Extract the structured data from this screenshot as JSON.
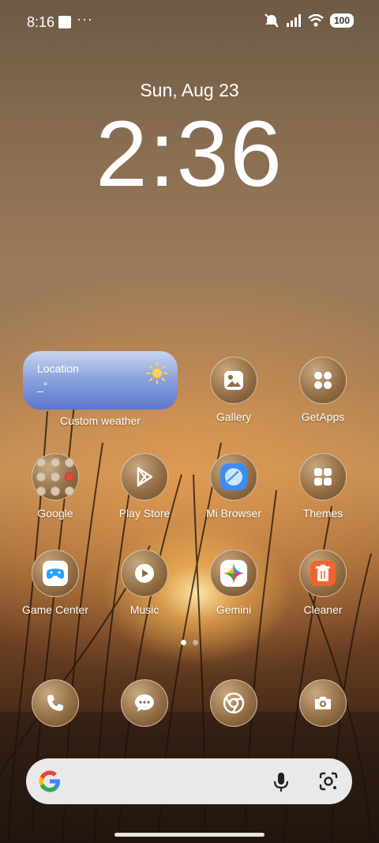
{
  "status_bar": {
    "time": "8:16",
    "notif_more": "···",
    "battery": "100"
  },
  "lockscreen": {
    "date": "Sun, Aug 23",
    "time": "2:36"
  },
  "weather_widget": {
    "location": "Location",
    "temp": "_°",
    "label": "Custom weather"
  },
  "apps": [
    {
      "label": "Gallery",
      "icon": "gallery-icon"
    },
    {
      "label": "GetApps",
      "icon": "getapps-icon"
    },
    {
      "label": "Google",
      "icon": "folder-icon"
    },
    {
      "label": "Play Store",
      "icon": "play-store-icon"
    },
    {
      "label": "Mi Browser",
      "icon": "browser-icon"
    },
    {
      "label": "Themes",
      "icon": "themes-icon"
    },
    {
      "label": "Game Center",
      "icon": "gamepad-icon"
    },
    {
      "label": "Music",
      "icon": "music-icon"
    },
    {
      "label": "Gemini",
      "icon": "gemini-icon"
    },
    {
      "label": "Cleaner",
      "icon": "trash-icon"
    }
  ],
  "dock": [
    {
      "name": "phone",
      "icon": "phone-icon"
    },
    {
      "name": "messages",
      "icon": "messages-icon"
    },
    {
      "name": "chrome",
      "icon": "chrome-icon"
    },
    {
      "name": "camera",
      "icon": "camera-icon"
    }
  ],
  "pager": {
    "pages": 2,
    "active": 1
  },
  "colors": {
    "search_bg": "#e9e9ea",
    "weather_top": "#c9d5ef",
    "weather_bottom": "#5b76cf",
    "cleaner": "#f0652f"
  }
}
